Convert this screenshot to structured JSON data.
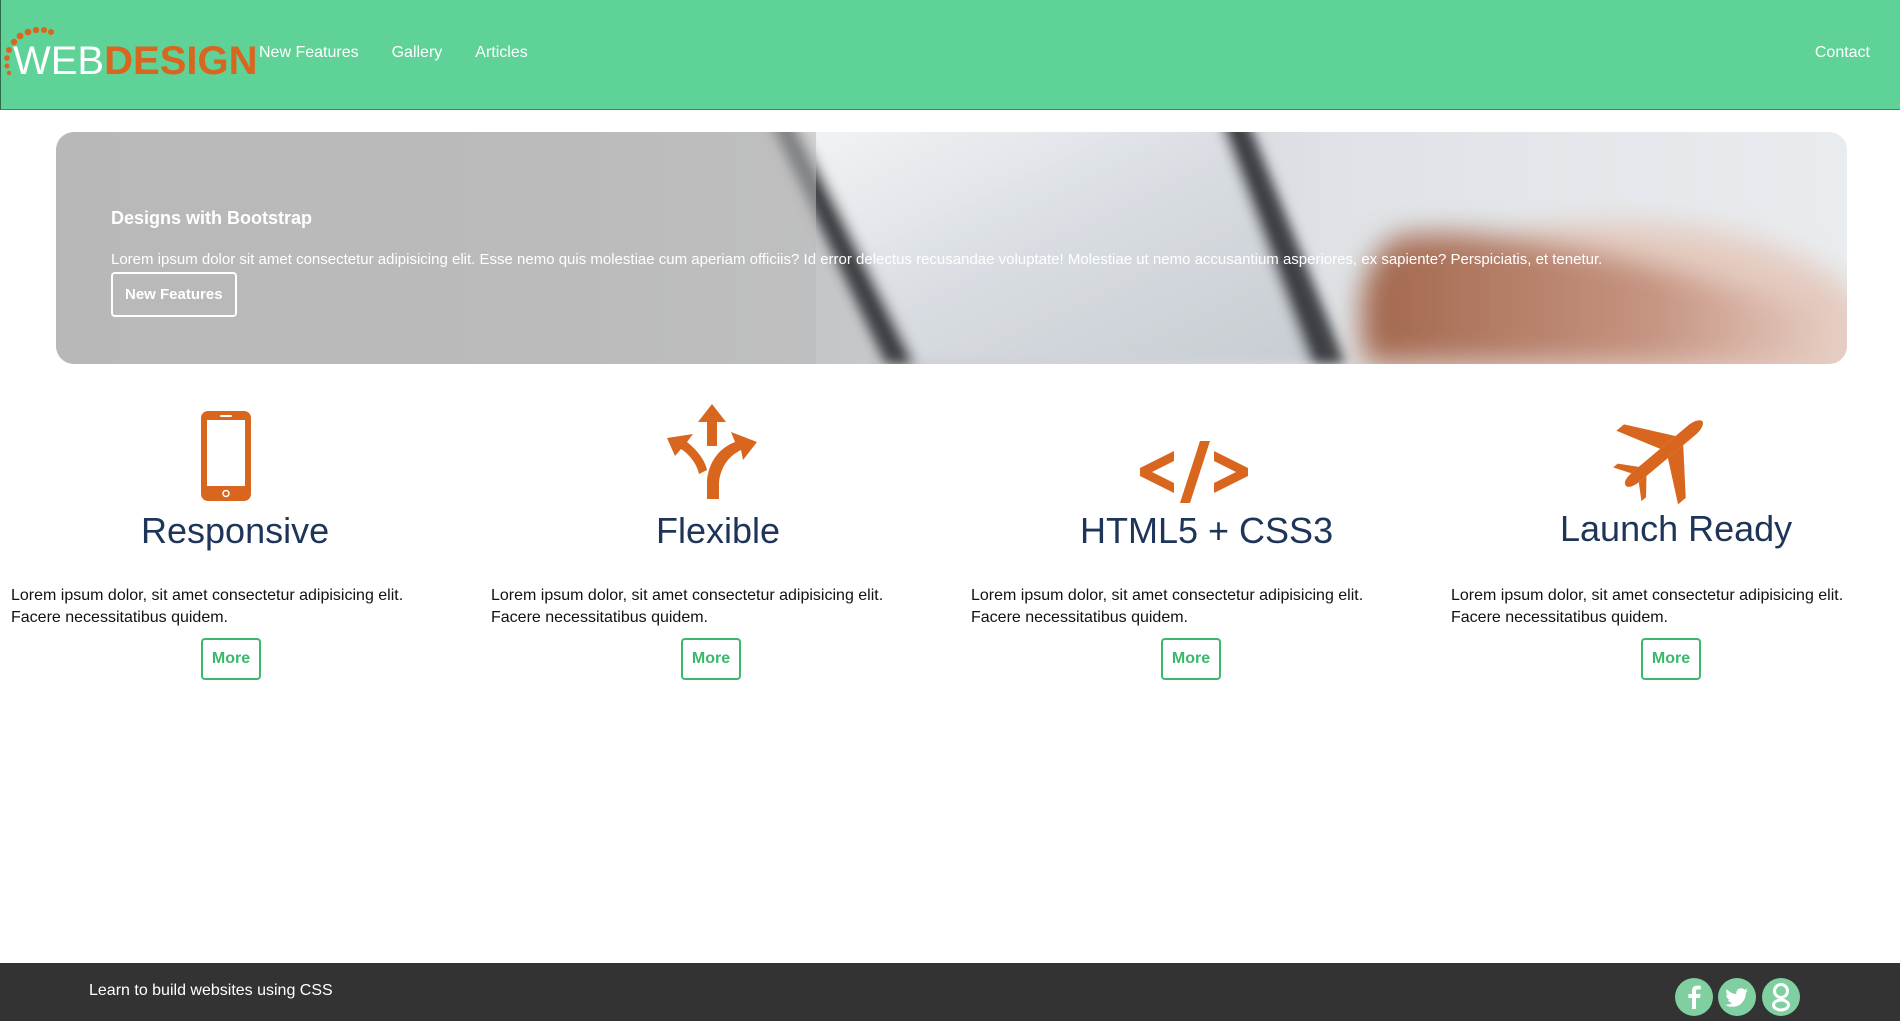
{
  "navbar": {
    "logo_web": "WEB",
    "logo_design": "DESIGN",
    "links": [
      "New Features",
      "Gallery",
      "Articles"
    ],
    "contact": "Contact",
    "bg_color": "#5fd297"
  },
  "hero": {
    "title": "Designs with Bootstrap",
    "text": "Lorem ipsum dolor sit amet consectetur adipisicing elit. Esse nemo quis molestiae cum aperiam officiis? Id error delectus recusandae voluptate! Molestiae ut nemo accusantium asperiores, ex sapiente? Perspiciatis, et tenetur.",
    "button": "New Features"
  },
  "features": [
    {
      "icon": "mobile-phone-icon",
      "title": "Responsive",
      "text": "Lorem ipsum dolor, sit amet consectetur adipisicing elit. Facere necessitatibus quidem.",
      "button": "More"
    },
    {
      "icon": "split-arrows-icon",
      "title": "Flexible",
      "text": "Lorem ipsum dolor, sit amet consectetur adipisicing elit. Facere necessitatibus quidem.",
      "button": "More"
    },
    {
      "icon": "code-icon",
      "title": "HTML5 + CSS3",
      "text": "Lorem ipsum dolor, sit amet consectetur adipisicing elit. Facere necessitatibus quidem.",
      "button": "More"
    },
    {
      "icon": "plane-icon",
      "title": "Launch Ready",
      "text": "Lorem ipsum dolor, sit amet consectetur adipisicing elit. Facere necessitatibus quidem.",
      "button": "More"
    }
  ],
  "footer": {
    "text": "Learn to build websites using CSS",
    "social_icons": [
      "facebook-icon",
      "twitter-icon",
      "google-icon"
    ]
  },
  "colors": {
    "accent_orange": "#d9661f",
    "accent_green": "#3cb86d",
    "heading_blue": "#1e3559",
    "footer_bg": "#333333"
  }
}
